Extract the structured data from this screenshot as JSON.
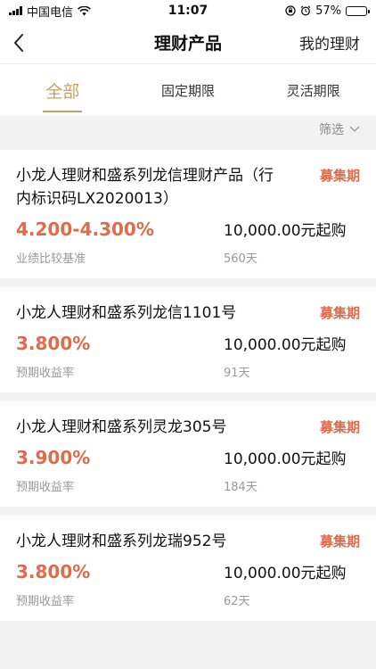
{
  "status_bar": {
    "carrier": "中国电信",
    "time": "11:07",
    "battery_pct": "57%",
    "battery_fill": 0.57
  },
  "nav": {
    "title": "理财产品",
    "right_link": "我的理财"
  },
  "tabs": [
    {
      "label": "全部",
      "active": true
    },
    {
      "label": "固定期限",
      "active": false
    },
    {
      "label": "灵活期限",
      "active": false
    }
  ],
  "filter": {
    "label": "筛选"
  },
  "colors": {
    "accent_gold": "#c9a063",
    "rate_red": "#e26a4a"
  },
  "products": [
    {
      "name": "小龙人理财和盛系列龙信理财产品（行内标识码LX2020013）",
      "status": "募集期",
      "rate": "4.200-4.300%",
      "rate_label": "业绩比较基准",
      "min_buy": "10,000.00元起购",
      "term": "560天"
    },
    {
      "name": "小龙人理财和盛系列龙信1101号",
      "status": "募集期",
      "rate": "3.800%",
      "rate_label": "预期收益率",
      "min_buy": "10,000.00元起购",
      "term": "91天"
    },
    {
      "name": "小龙人理财和盛系列灵龙305号",
      "status": "募集期",
      "rate": "3.900%",
      "rate_label": "预期收益率",
      "min_buy": "10,000.00元起购",
      "term": "184天"
    },
    {
      "name": "小龙人理财和盛系列龙瑞952号",
      "status": "募集期",
      "rate": "3.800%",
      "rate_label": "预期收益率",
      "min_buy": "10,000.00元起购",
      "term": "62天"
    }
  ]
}
